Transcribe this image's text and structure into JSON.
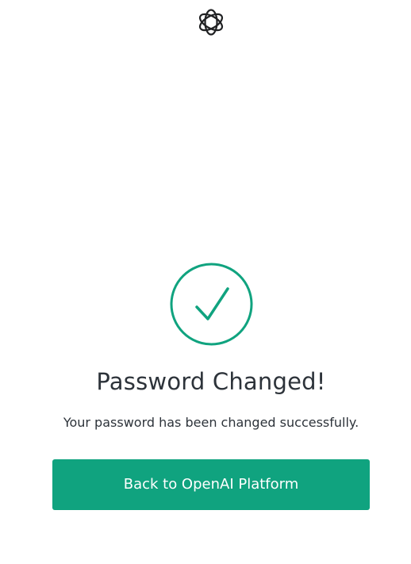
{
  "brand": {
    "logo_icon": "openai-logo-icon"
  },
  "status": {
    "icon": "check-circle-icon",
    "color": "#10a37f"
  },
  "content": {
    "title": "Password Changed!",
    "message": "Your password has been changed successfully."
  },
  "actions": {
    "back_label": "Back to OpenAI Platform",
    "button_color": "#10a37f"
  }
}
